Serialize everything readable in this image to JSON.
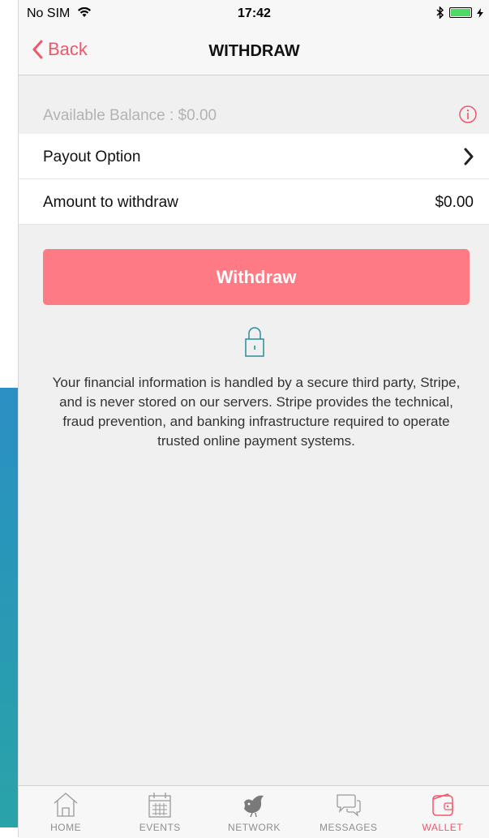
{
  "status_bar": {
    "carrier": "No SIM",
    "time": "17:42"
  },
  "nav": {
    "back_label": "Back",
    "title": "WITHDRAW"
  },
  "balance": {
    "label": "Available Balance : $0.00"
  },
  "payout_option": {
    "label": "Payout Option"
  },
  "amount": {
    "label": "Amount to withdraw",
    "value": "$0.00"
  },
  "withdraw_button": {
    "label": "Withdraw"
  },
  "secure_text": "Your financial information is handled by a secure third party, Stripe, and is never stored on our servers. Stripe provides the technical, fraud prevention, and banking infrastructure required to operate trusted online payment systems.",
  "tabs": [
    {
      "label": "HOME",
      "icon": "home-icon",
      "active": false
    },
    {
      "label": "EVENTS",
      "icon": "calendar-icon",
      "active": false
    },
    {
      "label": "NETWORK",
      "icon": "bird-icon",
      "active": false
    },
    {
      "label": "MESSAGES",
      "icon": "chat-bubbles-icon",
      "active": false
    },
    {
      "label": "WALLET",
      "icon": "wallet-icon",
      "active": true
    }
  ],
  "colors": {
    "accent": "#f0576b",
    "withdraw_button_bg": "#fe7b86",
    "lock_icon": "#2a8d9a",
    "page_bg": "#f0f0f0"
  }
}
